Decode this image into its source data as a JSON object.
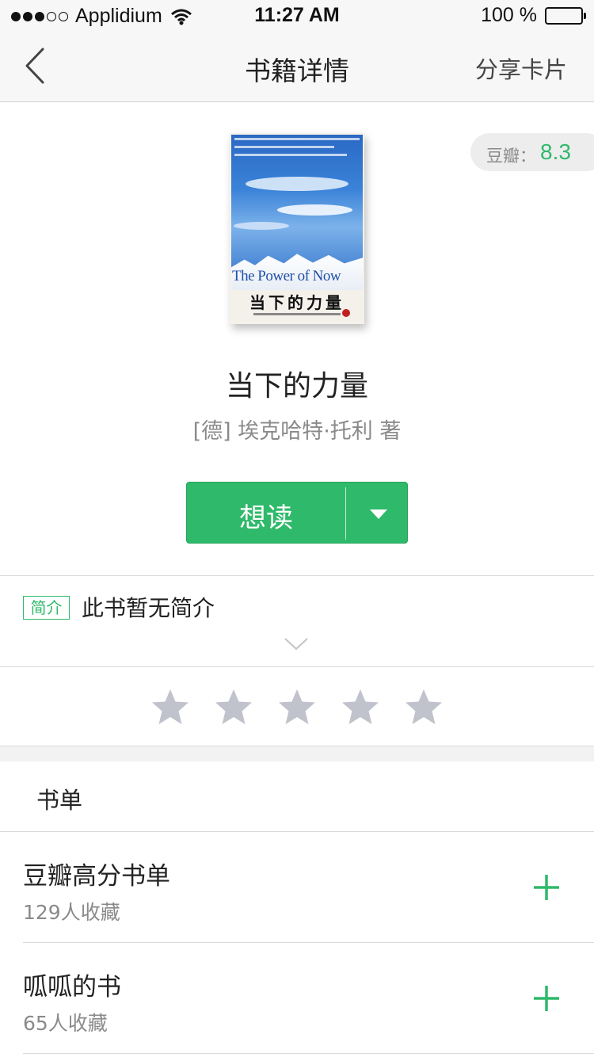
{
  "status_bar": {
    "carrier": "Applidium",
    "time": "11:27 AM",
    "battery": "100 %"
  },
  "nav": {
    "title": "书籍详情",
    "share_label": "分享卡片"
  },
  "book": {
    "cover_title_en": "The Power of Now",
    "cover_title_cn": "当下的力量",
    "title": "当下的力量",
    "author": "[德] 埃克哈特·托利 著",
    "rating_label": "豆瓣：",
    "rating_score": "8.3"
  },
  "want_button": {
    "label": "想读"
  },
  "intro": {
    "tag": "简介",
    "text": "此书暂无简介"
  },
  "rating_stars": {
    "max": 5,
    "filled": 0,
    "star_color": "#c0c2cc"
  },
  "booklists": {
    "section_title": "书单",
    "items": [
      {
        "name": "豆瓣高分书单",
        "count": "129人收藏"
      },
      {
        "name": "呱呱的书",
        "count": "65人收藏"
      }
    ]
  },
  "colors": {
    "accent": "#2fb96a",
    "secondary_text": "#8a8a8a",
    "background": "#ffffff",
    "bar_background": "#f7f7f7"
  }
}
